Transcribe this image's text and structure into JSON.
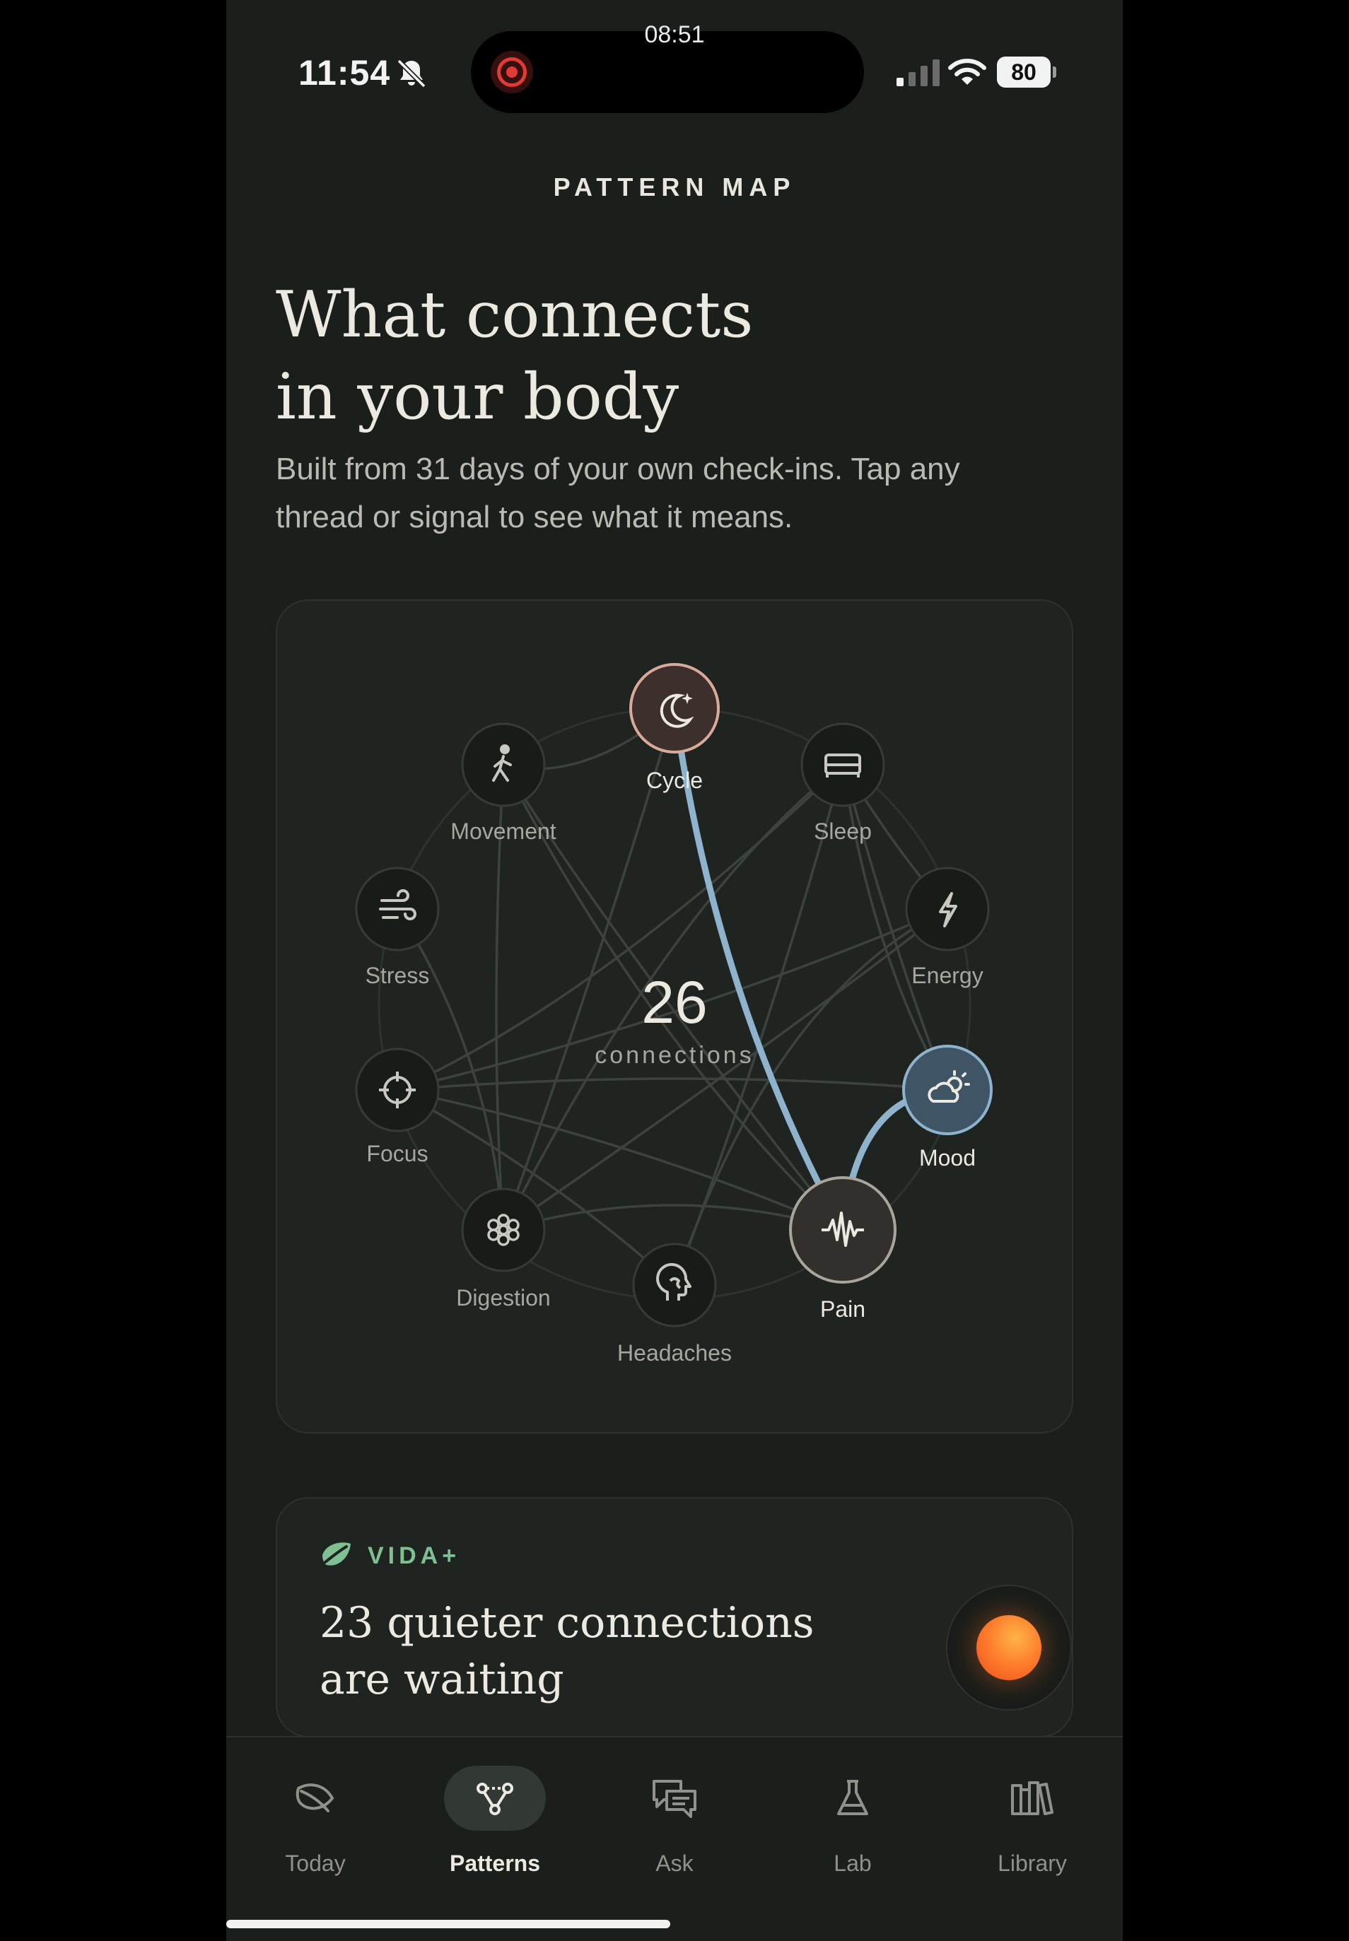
{
  "recording": {
    "time": "08:51"
  },
  "status_bar": {
    "time": "11:54",
    "battery": "80"
  },
  "header": {
    "title": "PATTERN MAP"
  },
  "hero": {
    "title_line1": "What connects",
    "title_line2": "in your body",
    "subtitle": "Built from 31 days of your own check-ins. Tap any thread or signal to see what it means."
  },
  "map": {
    "count": "26",
    "count_label": "connections",
    "nodes": [
      {
        "key": "cycle",
        "label": "Cycle",
        "icon": "moon-stars-icon",
        "active": true
      },
      {
        "key": "sleep",
        "label": "Sleep",
        "icon": "bed-icon",
        "active": false
      },
      {
        "key": "energy",
        "label": "Energy",
        "icon": "lightning-icon",
        "active": false
      },
      {
        "key": "mood",
        "label": "Mood",
        "icon": "cloud-sun-icon",
        "active": true
      },
      {
        "key": "pain",
        "label": "Pain",
        "icon": "waveform-icon",
        "active": true
      },
      {
        "key": "headaches",
        "label": "Headaches",
        "icon": "brain-head-icon",
        "active": false
      },
      {
        "key": "digestion",
        "label": "Digestion",
        "icon": "flower-icon",
        "active": false
      },
      {
        "key": "focus",
        "label": "Focus",
        "icon": "crosshair-icon",
        "active": false
      },
      {
        "key": "stress",
        "label": "Stress",
        "icon": "wind-icon",
        "active": false
      },
      {
        "key": "movement",
        "label": "Movement",
        "icon": "walking-icon",
        "active": false
      }
    ],
    "highlighted_connections": [
      [
        "cycle",
        "pain"
      ],
      [
        "mood",
        "pain"
      ]
    ]
  },
  "vida": {
    "tag": "VIDA+",
    "text_line1": "23 quieter connections",
    "text_line2": "are waiting"
  },
  "tabs": [
    {
      "label": "Today",
      "icon": "leaf-icon",
      "active": false
    },
    {
      "label": "Patterns",
      "icon": "nodes-icon",
      "active": true
    },
    {
      "label": "Ask",
      "icon": "chat-bubbles-icon",
      "active": false
    },
    {
      "label": "Lab",
      "icon": "flask-icon",
      "active": false
    },
    {
      "label": "Library",
      "icon": "books-icon",
      "active": false
    }
  ],
  "colors": {
    "background": "#1a1f1b",
    "accent_blue": "#8fb3cc",
    "cycle_accent": "#d9a99a",
    "vida_green": "#7fbf92",
    "orb": "#ff7a2b"
  }
}
